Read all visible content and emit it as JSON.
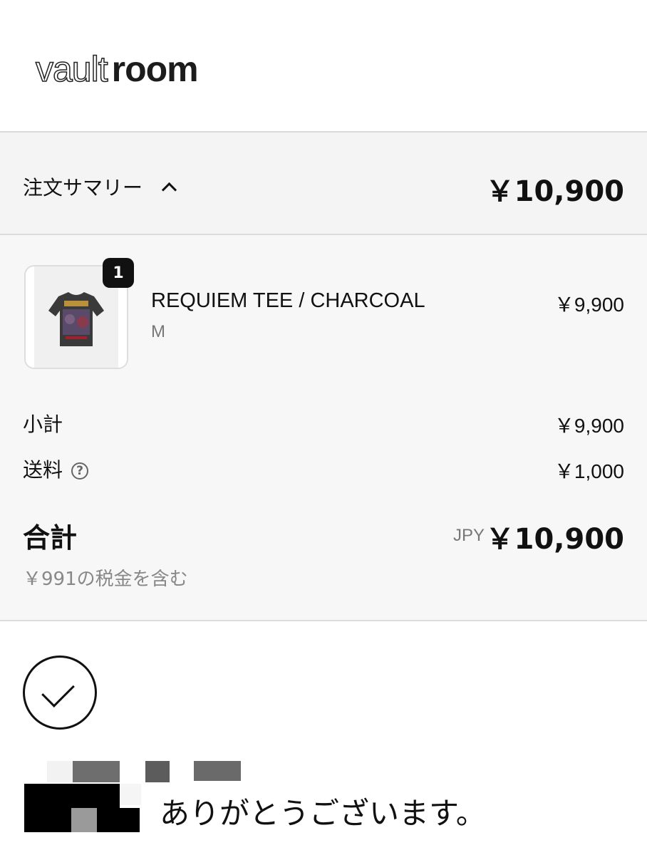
{
  "header": {
    "logo_part1": "vault",
    "logo_part2": "room"
  },
  "summary": {
    "label": "注文サマリー",
    "total": "￥10,900"
  },
  "item": {
    "quantity": "1",
    "name": "REQUIEM TEE / CHARCOAL",
    "variant": "M",
    "price": "￥9,900",
    "image_icon": "tshirt-image"
  },
  "subtotal": {
    "label": "小計",
    "value": "￥9,900"
  },
  "shipping": {
    "label": "送料",
    "help_icon": "question-circle-icon",
    "value": "￥1,000"
  },
  "total": {
    "label": "合計",
    "currency": "JPY",
    "value": "￥10,900",
    "tax_note": "￥991の税金を含む"
  },
  "confirmation": {
    "icon": "check-circle-icon",
    "message": "ありがとうございます。"
  }
}
